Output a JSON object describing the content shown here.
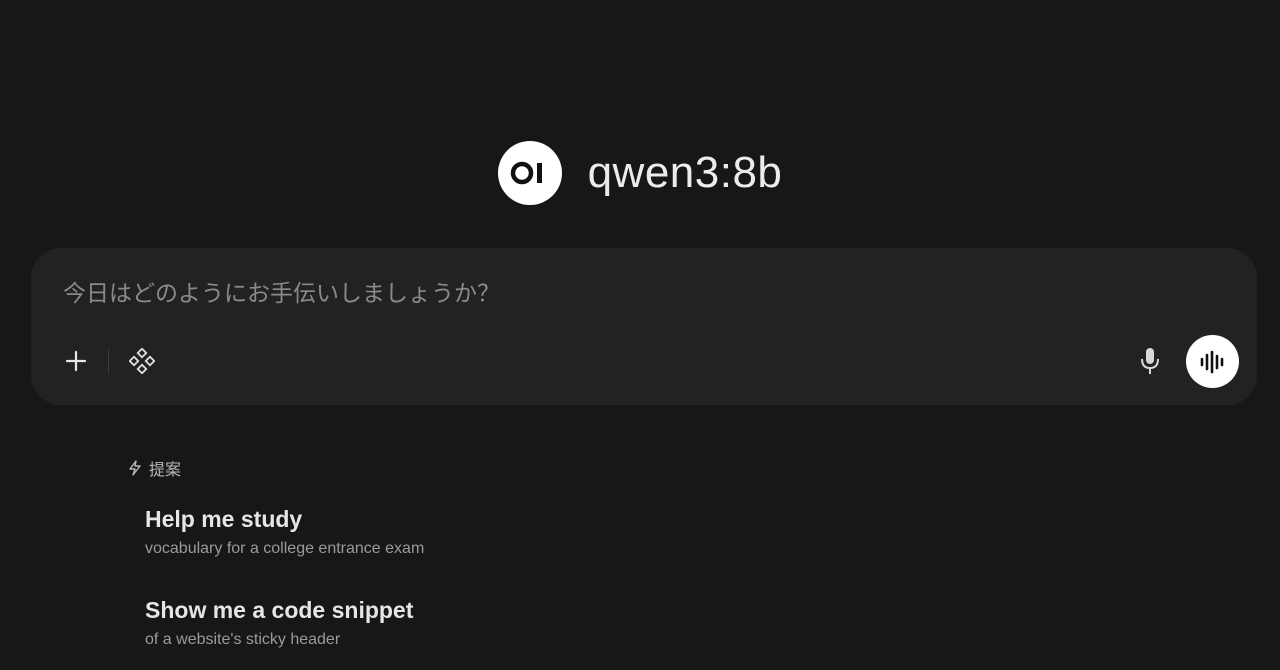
{
  "header": {
    "logo_text": "OI",
    "model_name": "qwen3:8b"
  },
  "chat_input": {
    "placeholder": "今日はどのようにお手伝いしましょうか？",
    "value": ""
  },
  "toolbar": {
    "icons": [
      "plus-icon",
      "tools-icon",
      "microphone-icon",
      "voice-waveform-icon"
    ]
  },
  "suggestions": {
    "header_label": "提案",
    "header_icon": "lightning-icon",
    "items": [
      {
        "title": "Help me study",
        "subtitle": "vocabulary for a college entrance exam"
      },
      {
        "title": "Show me a code snippet",
        "subtitle": "of a website's sticky header"
      }
    ]
  },
  "colors": {
    "background": "#171717",
    "input_background": "#222222",
    "accent": "#ffffff",
    "text_primary": "#e6e6e6",
    "text_secondary": "#9a9a9a"
  }
}
